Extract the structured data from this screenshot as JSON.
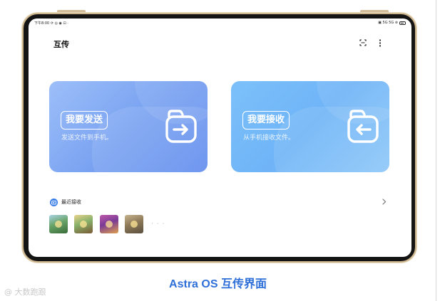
{
  "status_bar": {
    "time_text": "下午8:00",
    "left_icons": "⟳ ◎ ◉ ⊡ ·",
    "right_icons": "▣ 5G 5G ⊚"
  },
  "header": {
    "title": "互传",
    "scan_icon": "scan-icon",
    "more_icon": "more-vertical-icon"
  },
  "cards": {
    "send": {
      "title": "我要发送",
      "subtitle": "发送文件到手机。",
      "icon": "folder-arrow-right-icon"
    },
    "receive": {
      "title": "我要接收",
      "subtitle": "从手机接收文件。",
      "icon": "folder-arrow-left-icon"
    }
  },
  "recent": {
    "label": "最近接收",
    "more": "· · ·"
  },
  "caption": "Astra OS 互传界面",
  "watermark": "@ 大数跑跟",
  "colors": {
    "accent": "#2f6fd8",
    "send_card": "#7aa3f1",
    "receive_card": "#6fb4f7",
    "device_frame": "#cdb68e"
  }
}
